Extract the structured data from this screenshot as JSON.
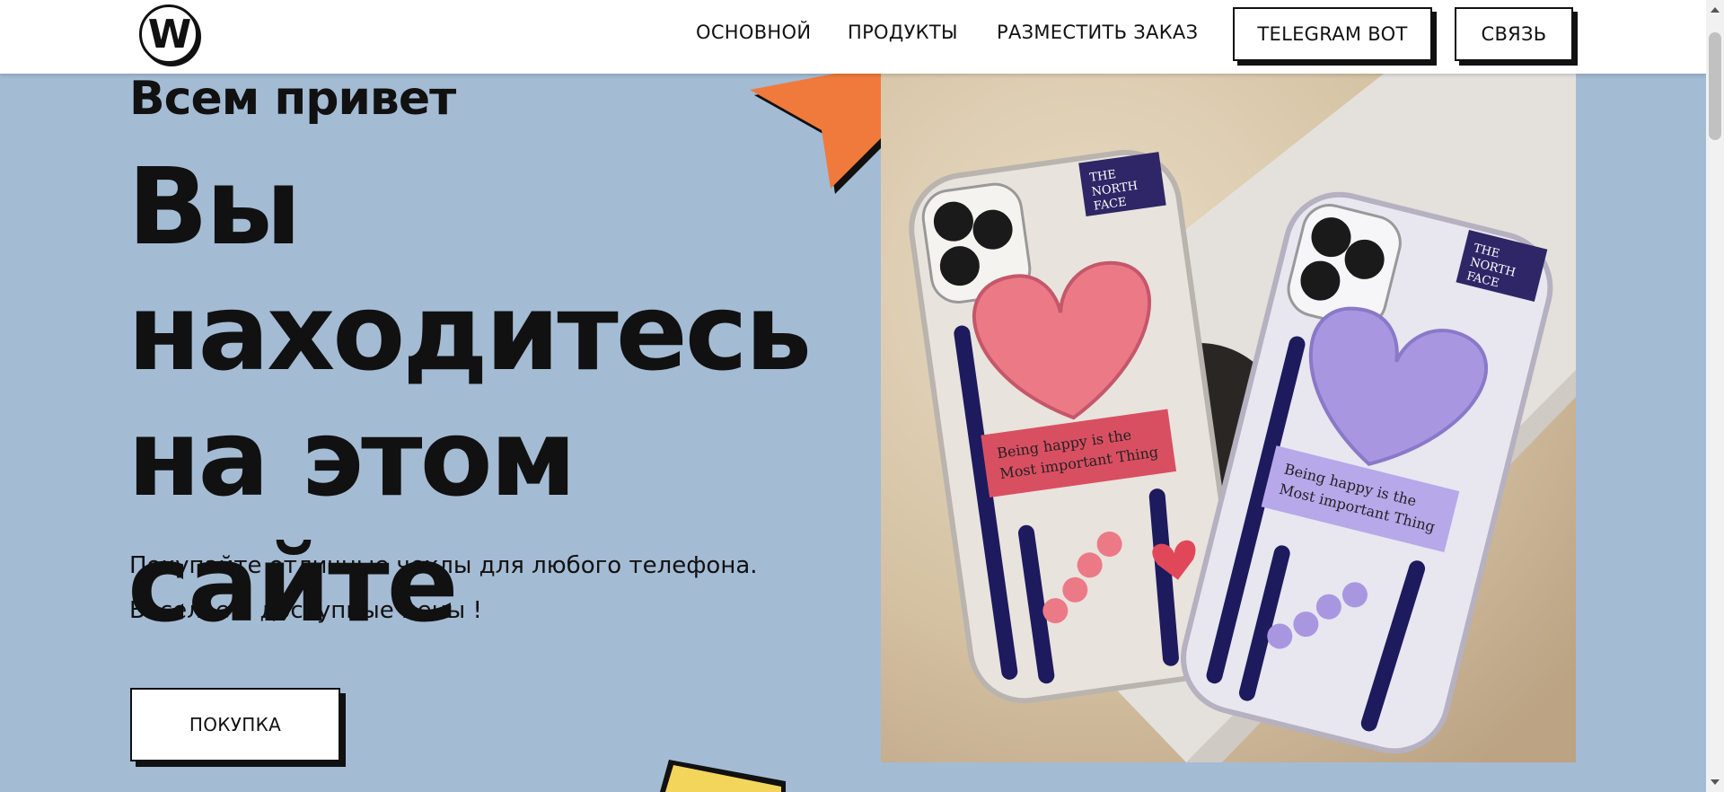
{
  "header": {
    "logo_letter": "W",
    "nav": {
      "home": "ОСНОВНОЙ",
      "products": "ПРОДУКТЫ",
      "order": "РАЗМЕСТИТЬ ЗАКАЗ",
      "telegram": "TELEGRAM BOT",
      "contact": "СВЯЗЬ"
    }
  },
  "hero": {
    "greeting": "Всем привет",
    "headline": "Вы находитесь на этом сайте",
    "subtext_line1": "Покупайте отличные чехлы для любого телефона.",
    "subtext_line2": "Веселье и доступные цены !",
    "buy_button": "ПОКУПКА"
  },
  "photo": {
    "case_text_line1": "Being happy is the",
    "case_text_line2": "Most important Thing",
    "brand_line1": "THE",
    "brand_line2": "NORTH",
    "brand_line3": "FACE"
  },
  "colors": {
    "background": "#a4bbd4",
    "accent_orange": "#f07a3c",
    "accent_yellow": "#f4d55c",
    "pink_heart": "#ec7a86",
    "purple_heart": "#a897e0"
  }
}
